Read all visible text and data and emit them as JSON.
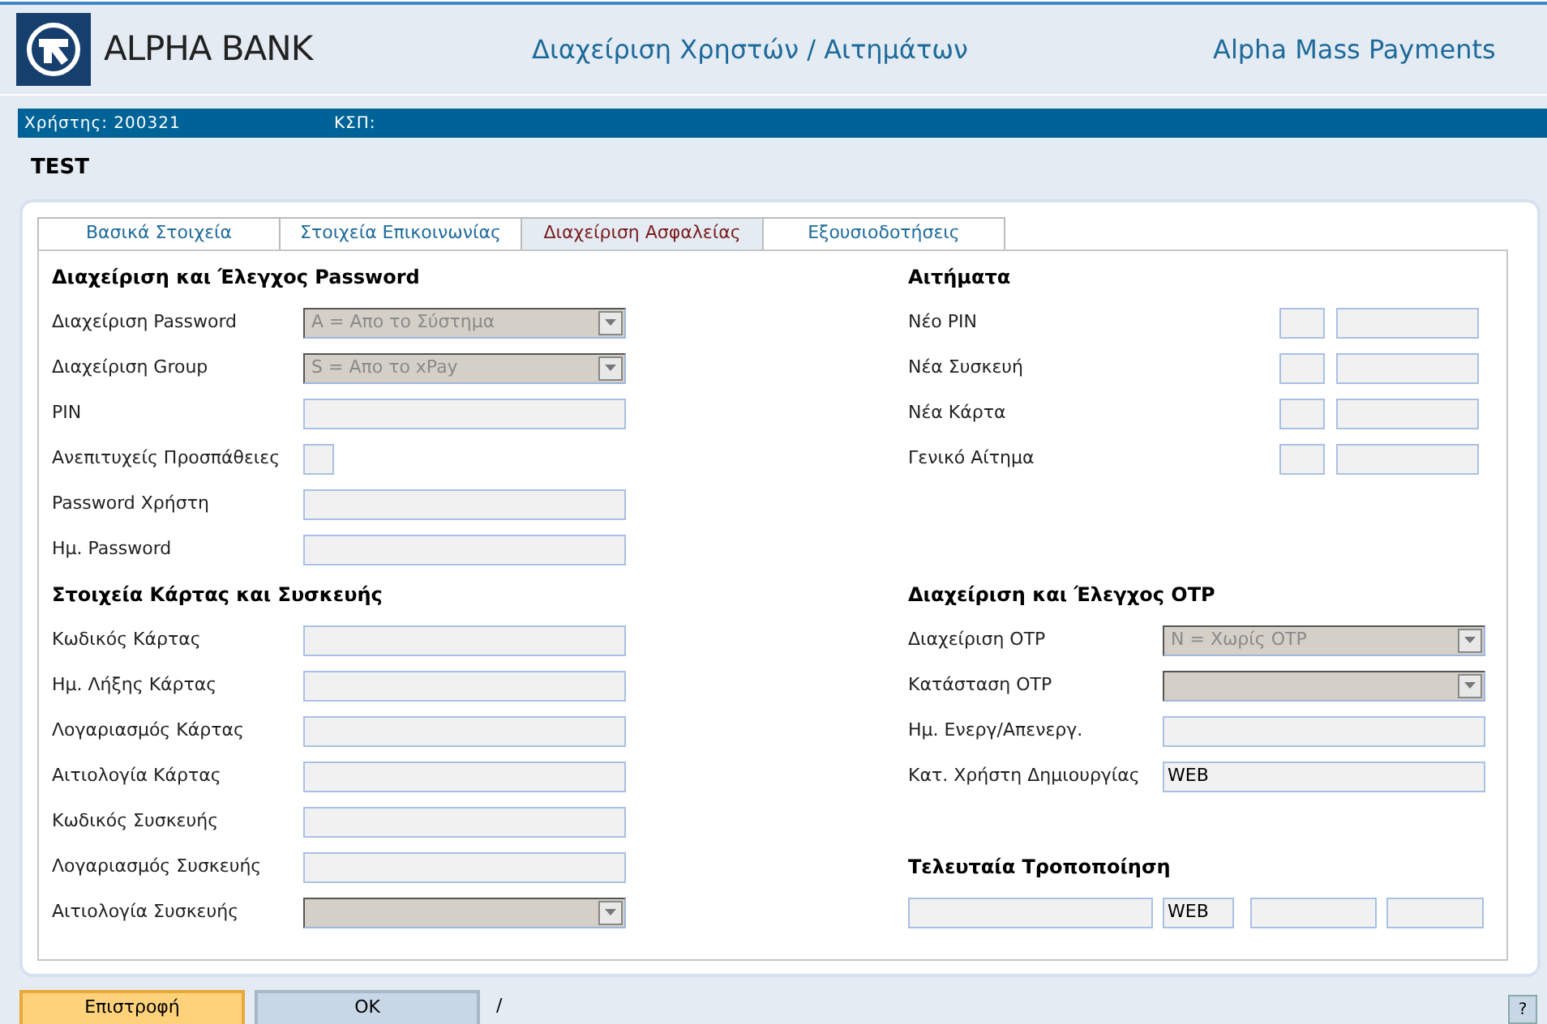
{
  "header": {
    "bank_name": "ALPHA BANK",
    "title": "Διαχείριση Χρηστών / Αιτημάτων",
    "app_name": "Alpha Mass Payments"
  },
  "info_bar": [
    {
      "label": "Χρήστης:",
      "value": "200321"
    },
    {
      "label": "ΚΣΠ:"
    }
  ],
  "page_title": "TEST",
  "tabs": [
    {
      "label": "Βασικά Στοιχεία",
      "selected": false
    },
    {
      "label": "Στοιχεία Επικοινωνίας",
      "selected": false
    },
    {
      "label": "Διαχείριση Ασφαλείας",
      "selected": true
    },
    {
      "label": "Εξουσιοδοτήσεις",
      "selected": false
    }
  ],
  "left_sections": [
    {
      "title": "Διαχείριση και Έλεγχος Password",
      "fields": [
        {
          "label": "Διαχείριση Password",
          "kind": "select",
          "value": "A = Απο το Σύστημα"
        },
        {
          "label": "Διαχείριση Group",
          "kind": "select",
          "value": "S = Απο το xPay"
        },
        {
          "label": "PIN",
          "kind": "text"
        },
        {
          "label": "Ανεπιτυχείς Προσπάθειες",
          "kind": "small"
        },
        {
          "label": "Password Χρήστη",
          "kind": "text"
        },
        {
          "label": "Ημ. Password",
          "kind": "text"
        }
      ]
    },
    {
      "title": "Στοιχεία Κάρτας και Συσκευής",
      "fields": [
        {
          "label": "Κωδικός Κάρτας",
          "kind": "text"
        },
        {
          "label": "Ημ. Λήξης Κάρτας",
          "kind": "text"
        },
        {
          "label": "Λογαριασμός Κάρτας",
          "kind": "text"
        },
        {
          "label": "Αιτιολογία Κάρτας",
          "kind": "text"
        },
        {
          "label": "Κωδικός Συσκευής",
          "kind": "text"
        },
        {
          "label": "Λογαριασμός Συσκευής",
          "kind": "text"
        },
        {
          "label": "Αιτιολογία Συσκευής",
          "kind": "select"
        }
      ]
    }
  ],
  "requests": {
    "title": "Αιτήματα",
    "fields": [
      {
        "label": "Νέο PIN",
        "kind": "pair"
      },
      {
        "label": "Νέα Συσκευή",
        "kind": "pair"
      },
      {
        "label": "Νέα Κάρτα",
        "kind": "pair"
      },
      {
        "label": "Γενικό Αίτημα",
        "kind": "pair"
      }
    ]
  },
  "otp": {
    "title": "Διαχείριση και Έλεγχος OTP",
    "fields": [
      {
        "label": "Διαχείριση OTP",
        "kind": "select",
        "value": "N = Χωρίς OTP"
      },
      {
        "label": "Κατάσταση OTP",
        "kind": "select"
      },
      {
        "label": "Ημ. Ενεργ/Απενεργ.",
        "kind": "text"
      },
      {
        "label": "Κατ. Χρήστη Δημιουργίας",
        "kind": "text",
        "value": "WEB"
      }
    ]
  },
  "last_modification": {
    "title": "Τελευταία Τροποποίηση",
    "fields": [
      {
        "kind": "text"
      },
      {
        "kind": "text",
        "value": "WEB"
      },
      {
        "kind": "text"
      },
      {
        "kind": "text"
      }
    ]
  },
  "buttons": [
    {
      "label": "Επιστροφή",
      "kind": "primary"
    },
    {
      "label": "OK",
      "kind": "secondary"
    }
  ],
  "separator": "/",
  "help_button": "?"
}
